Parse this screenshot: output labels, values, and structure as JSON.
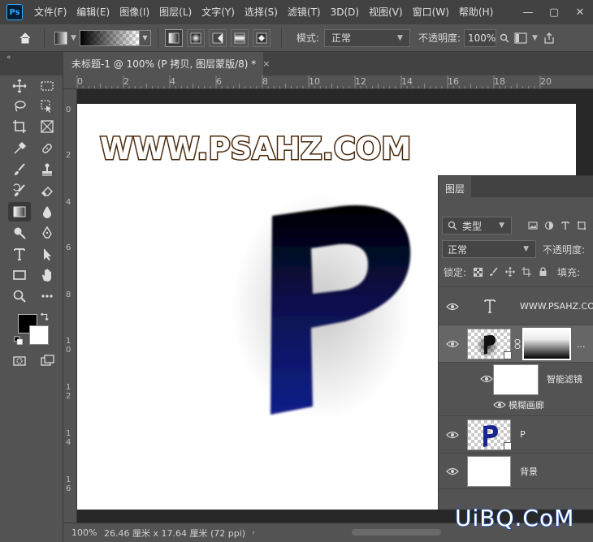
{
  "menubar": {
    "app_logo": "Ps",
    "items": [
      "文件(F)",
      "编辑(E)",
      "图像(I)",
      "图层(L)",
      "文字(Y)",
      "选择(S)",
      "滤镜(T)",
      "3D(D)",
      "视图(V)",
      "窗口(W)",
      "帮助(H)"
    ],
    "window_buttons": [
      "—",
      "▢",
      "✕"
    ]
  },
  "options_bar": {
    "mode_label": "模式:",
    "mode_value": "正常",
    "opacity_label": "不透明度:",
    "opacity_value": "100%"
  },
  "document": {
    "tab_title": "未标题-1 @ 100% (P 拷贝, 图层蒙版/8) *",
    "close_glyph": "×"
  },
  "ruler": {
    "top_labels": [
      "0",
      "2",
      "4",
      "6",
      "8",
      "10",
      "12",
      "14",
      "16",
      "18",
      "20"
    ],
    "left_labels": [
      "0",
      "2",
      "4",
      "6",
      "8",
      "1\n0",
      "1\n2",
      "1\n4",
      "1\n6"
    ]
  },
  "canvas": {
    "site_text": "WWW.PSAHZ.COM",
    "big_letter": "P"
  },
  "status": {
    "zoom": "100%",
    "doc_info": "26.46 厘米 x 17.64 厘米 (72 ppi)"
  },
  "layers_panel": {
    "tab_label": "图层",
    "filter_kind": "类型",
    "blend_mode": "正常",
    "opacity_label": "不透明度:",
    "lock_label": "锁定:",
    "fill_label": "填充:",
    "layers": [
      {
        "name": "WWW.PSAHZ.COM",
        "type": "text",
        "visible": true
      },
      {
        "name": "",
        "type": "masked",
        "visible": true,
        "selected": true,
        "more": "..."
      },
      {
        "name": "智能滤镜",
        "type": "smart-filter",
        "visible": true
      },
      {
        "name": "模糊画廊",
        "type": "filter",
        "visible": true
      },
      {
        "name": "P",
        "type": "smart-object",
        "visible": true
      },
      {
        "name": "背景",
        "type": "background",
        "visible": true
      }
    ]
  },
  "watermark": "UiBQ.CoM",
  "colors": {
    "panel_bg": "#535353",
    "menubar_bg": "#424242",
    "p_letter_top": "#000000",
    "p_letter_bottom": "#0f1a7a",
    "site_text_stroke": "#4a2a0c",
    "watermark_stroke": "#1a4db8"
  }
}
